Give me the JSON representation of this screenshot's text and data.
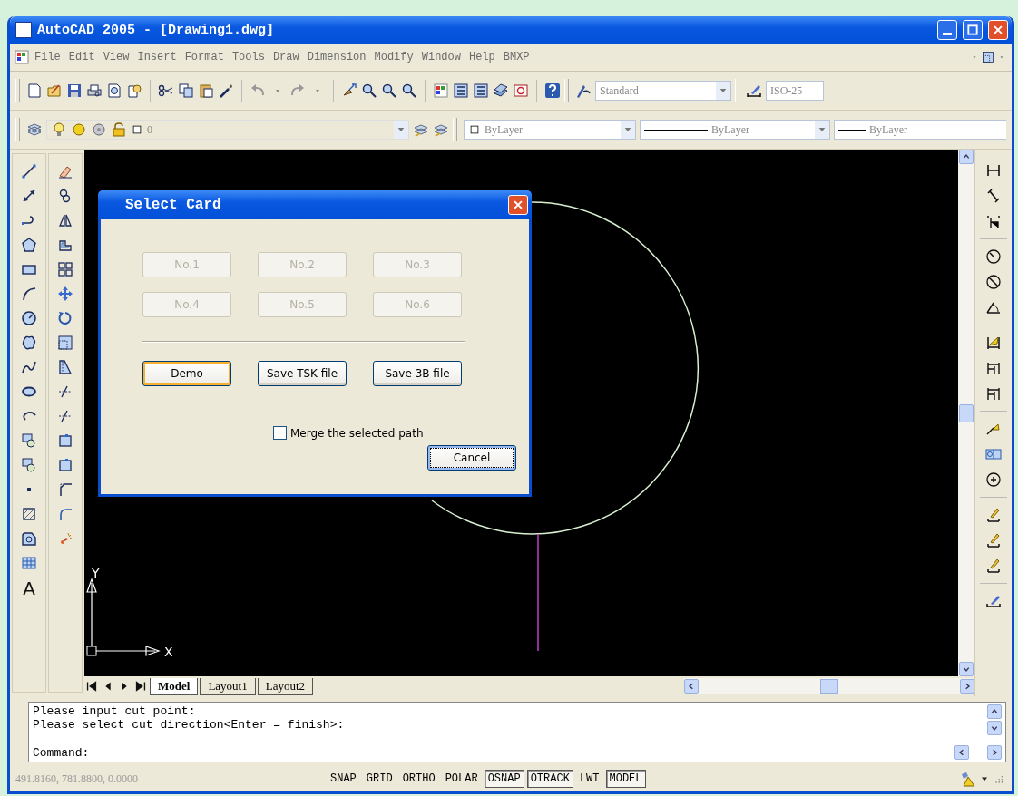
{
  "window": {
    "title": "AutoCAD 2005 - [Drawing1.dwg]"
  },
  "menu": {
    "items": [
      "File",
      "Edit",
      "View",
      "Insert",
      "Format",
      "Tools",
      "Draw",
      "Dimension",
      "Modify",
      "Window",
      "Help",
      "BMXP"
    ]
  },
  "styles_toolbar": {
    "text_style": "Standard",
    "dim_style": "ISO-25"
  },
  "layers_toolbar": {
    "layer": "0",
    "color_control": "ByLayer",
    "linetype": "ByLayer",
    "lineweight": "ByLayer"
  },
  "draw_toolbar": {
    "text_tool": "A"
  },
  "canvas": {
    "y_axis_label": "Y",
    "x_axis_label": "X"
  },
  "layout_tabs": [
    {
      "label": "Model",
      "selected": true
    },
    {
      "label": "Layout1",
      "selected": false
    },
    {
      "label": "Layout2",
      "selected": false
    }
  ],
  "dialog": {
    "title": "Select Card",
    "cards": [
      {
        "label": "No.1",
        "disabled": true
      },
      {
        "label": "No.2",
        "disabled": true
      },
      {
        "label": "No.3",
        "disabled": true
      },
      {
        "label": "No.4",
        "disabled": true
      },
      {
        "label": "No.5",
        "disabled": true
      },
      {
        "label": "No.6",
        "disabled": true
      }
    ],
    "actions": [
      {
        "label": "Demo",
        "hovered": true
      },
      {
        "label": "Save TSK file",
        "hovered": false
      },
      {
        "label": "Save 3B file",
        "hovered": false
      }
    ],
    "merge_checkbox": {
      "label": "Merge the selected path",
      "checked": false
    },
    "cancel": {
      "label": "Cancel",
      "focused": true
    }
  },
  "command_history": [
    "Please input cut point:",
    "Please select cut direction<Enter = finish>:"
  ],
  "command_prompt": "Command:",
  "status_bar": {
    "coordinates": "491.8160, 781.8800, 0.0000",
    "toggles": [
      {
        "label": "SNAP",
        "on": false
      },
      {
        "label": "GRID",
        "on": false
      },
      {
        "label": "ORTHO",
        "on": false
      },
      {
        "label": "POLAR",
        "on": false
      },
      {
        "label": "OSNAP",
        "on": true
      },
      {
        "label": "OTRACK",
        "on": true
      },
      {
        "label": "LWT",
        "on": false
      },
      {
        "label": "MODEL",
        "on": true
      }
    ]
  }
}
